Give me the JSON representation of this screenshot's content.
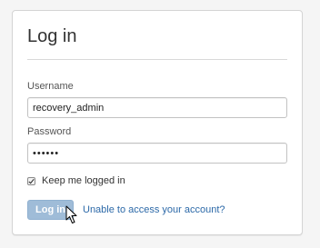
{
  "form": {
    "title": "Log in",
    "username_label": "Username",
    "username_value": "recovery_admin",
    "password_label": "Password",
    "password_value": "••••••",
    "remember_label": "Keep me logged in",
    "remember_checked": true,
    "login_button": "Log in",
    "help_link": "Unable to access your account?"
  },
  "colors": {
    "button_bg": "#9fbcd8",
    "link": "#2c69a8"
  },
  "icons": {
    "cursor": "mouse-pointer-icon",
    "checkbox": "checkmark-icon"
  }
}
